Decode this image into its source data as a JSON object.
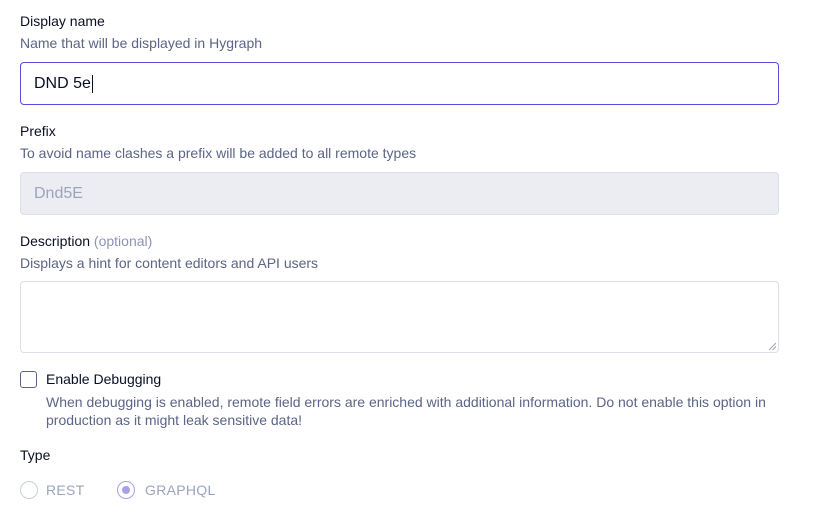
{
  "display_name": {
    "label": "Display name",
    "hint": "Name that will be displayed in Hygraph",
    "value": "DND 5e"
  },
  "prefix": {
    "label": "Prefix",
    "hint": "To avoid name clashes a prefix will be added to all remote types",
    "value": "Dnd5E"
  },
  "description": {
    "label": "Description",
    "optional": "(optional)",
    "hint": "Displays a hint for content editors and API users",
    "value": ""
  },
  "debugging": {
    "label": "Enable Debugging",
    "description": "When debugging is enabled, remote field errors are enriched with additional information. Do not enable this option in production as it might leak sensitive data!",
    "checked": false
  },
  "type": {
    "label": "Type",
    "options": [
      {
        "label": "REST",
        "selected": false
      },
      {
        "label": "GRAPHQL",
        "selected": true
      }
    ]
  },
  "colors": {
    "focus_border": "#5b4cdb",
    "radio_accent": "#a8a1e6",
    "hint_text": "#5b6585"
  }
}
